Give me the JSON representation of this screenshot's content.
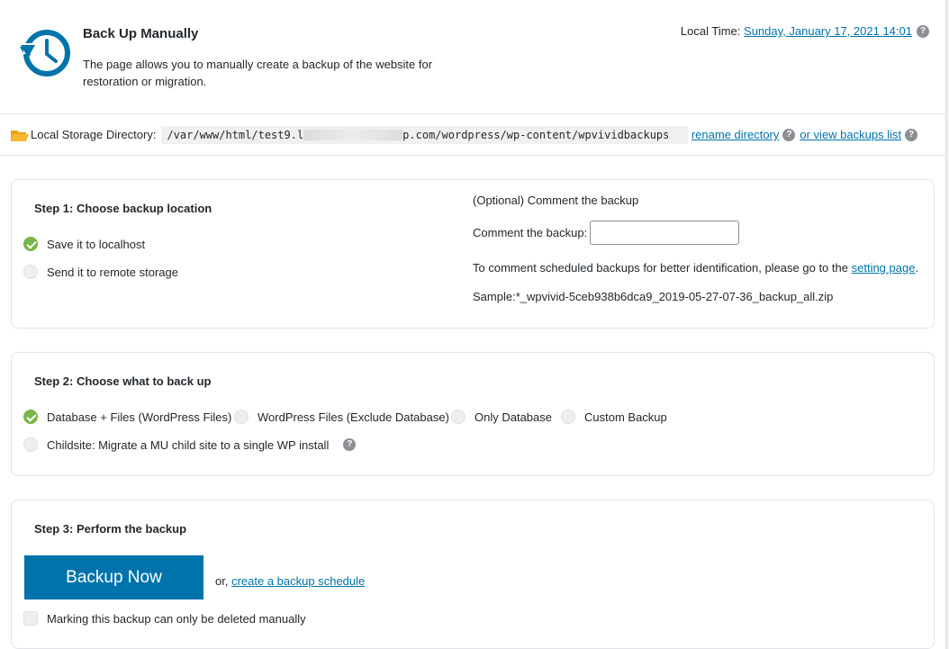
{
  "header": {
    "title": "Back Up Manually",
    "description": "The page allows you to manually create a backup of the website for restoration or migration.",
    "local_time_label": "Local Time:",
    "local_time_value": "Sunday, January 17, 2021 14:01",
    "help_glyph": "?"
  },
  "storage": {
    "label": "Local Storage Directory:",
    "path_start": "/var/www/html/test9.l",
    "path_end": "p.com/wordpress/wp-content/wpvividbackups",
    "rename_link": "rename directory",
    "view_link": "or view backups list"
  },
  "step1": {
    "title": "Step 1: Choose backup location",
    "option_local": "Save it to localhost",
    "option_remote": "Send it to remote storage",
    "comment_header": "(Optional) Comment the backup",
    "comment_label": "Comment the backup:",
    "comment_value": "",
    "hint_text": "To comment scheduled backups for better identification, please go to the",
    "hint_link": "setting page",
    "hint_end": ".",
    "sample": "Sample:*_wpvivid-5ceb938b6dca9_2019-05-27-07-36_backup_all.zip"
  },
  "step2": {
    "title": "Step 2: Choose what to back up",
    "options": [
      "Database + Files (WordPress Files)",
      "WordPress Files (Exclude Database)",
      "Only Database",
      "Custom Backup"
    ],
    "childsite": "Childsite: Migrate a MU child site to a single WP install"
  },
  "step3": {
    "title": "Step 3: Perform the backup",
    "button": "Backup Now",
    "or_text": "or,",
    "schedule_link": "create a backup schedule",
    "mark_label": "Marking this backup can only be deleted manually"
  },
  "colors": {
    "accent": "#0073aa",
    "check": "#7ab648"
  }
}
